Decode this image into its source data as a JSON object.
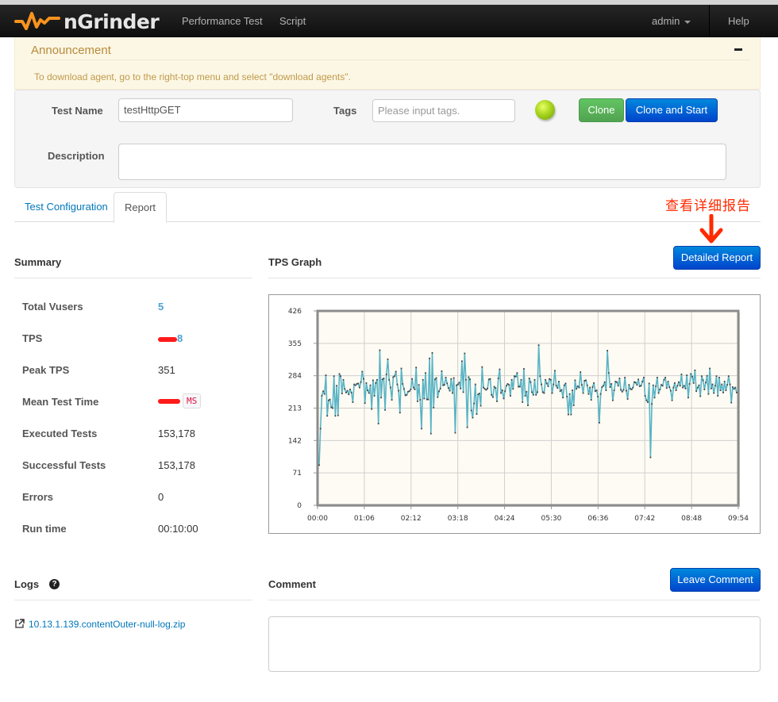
{
  "navbar": {
    "brand": "nGrinder",
    "links": [
      "Performance Test",
      "Script"
    ],
    "user": "admin",
    "help": "Help"
  },
  "announcement": {
    "title": "Announcement",
    "message": "To download agent, go to the right-top menu and select \"download agents\"."
  },
  "test_info": {
    "test_name_label": "Test Name",
    "test_name_value": "testHttpGET",
    "tags_label": "Tags",
    "tags_placeholder": "Please input tags.",
    "description_label": "Description",
    "description_value": "",
    "status": "finished",
    "clone_label": "Clone",
    "clone_start_label": "Clone and Start"
  },
  "tabs": [
    {
      "label": "Test Configuration",
      "active": false
    },
    {
      "label": "Report",
      "active": true
    }
  ],
  "annotation": {
    "text": "查看详细报告",
    "color": "#ff2a00"
  },
  "summary": {
    "title": "Summary",
    "rows": [
      {
        "label": "Total Vusers",
        "value": "5"
      },
      {
        "label": "TPS",
        "value": "[redacted]",
        "redacted": true
      },
      {
        "label": "Peak TPS",
        "value": "351"
      },
      {
        "label": "Mean Test Time",
        "value": "[redacted]",
        "redacted": true,
        "unit": "MS"
      },
      {
        "label": "Executed Tests",
        "value": "153,178"
      },
      {
        "label": "Successful Tests",
        "value": "153,178"
      },
      {
        "label": "Errors",
        "value": "0"
      },
      {
        "label": "Run time",
        "value": "00:10:00"
      }
    ]
  },
  "tps_graph": {
    "title": "TPS Graph",
    "detailed_report_label": "Detailed Report"
  },
  "logs": {
    "title": "Logs",
    "files": [
      "10.13.1.139.contentOuter-null-log.zip"
    ]
  },
  "comment": {
    "title": "Comment",
    "leave_comment_label": "Leave Comment",
    "value": ""
  },
  "chart_data": {
    "type": "line",
    "title": "TPS Graph",
    "xlabel": "",
    "ylabel": "",
    "x_ticks": [
      "00:00",
      "01:06",
      "02:12",
      "03:18",
      "04:24",
      "05:30",
      "06:36",
      "07:42",
      "08:48",
      "09:54"
    ],
    "y_ticks": [
      0,
      71,
      142,
      213,
      284,
      355,
      426
    ],
    "ylim": [
      0,
      426
    ],
    "xlim_seconds": [
      0,
      594
    ],
    "sample_interval_seconds": 3,
    "grid": true,
    "line_color": "#5ab4c5",
    "background": "#fdfbf3",
    "series": [
      {
        "name": "TPS",
        "values": [
          88,
          168,
          240,
          250,
          244,
          285,
          196,
          230,
          232,
          215,
          213,
          283,
          196,
          262,
          197,
          288,
          283,
          245,
          275,
          255,
          247,
          251,
          243,
          254,
          247,
          226,
          265,
          263,
          266,
          267,
          258,
          270,
          293,
          277,
          224,
          268,
          252,
          246,
          263,
          211,
          274,
          240,
          268,
          275,
          179,
          340,
          236,
          276,
          278,
          209,
          287,
          320,
          275,
          258,
          231,
          281,
          283,
          293,
          265,
          251,
          203,
          300,
          266,
          255,
          241,
          242,
          249,
          250,
          254,
          277,
          258,
          254,
          302,
          228,
          264,
          231,
          168,
          275,
          234,
          290,
          232,
          232,
          322,
          157,
          334,
          214,
          276,
          279,
          237,
          250,
          256,
          294,
          263,
          264,
          280,
          267,
          257,
          251,
          277,
          246,
          279,
          159,
          263,
          265,
          269,
          256,
          316,
          248,
          333,
          275,
          171,
          281,
          276,
          208,
          192,
          223,
          265,
          200,
          243,
          245,
          218,
          303,
          258,
          255,
          253,
          256,
          276,
          277,
          242,
          237,
          260,
          257,
          228,
          278,
          298,
          246,
          252,
          234,
          250,
          262,
          266,
          264,
          240,
          275,
          255,
          283,
          282,
          290,
          260,
          260,
          275,
          226,
          299,
          240,
          249,
          219,
          278,
          270,
          248,
          242,
          275,
          242,
          248,
          351,
          283,
          265,
          248,
          246,
          275,
          267,
          261,
          277,
          275,
          246,
          265,
          295,
          262,
          257,
          271,
          250,
          253,
          236,
          263,
          267,
          238,
          199,
          244,
          199,
          252,
          219,
          274,
          255,
          261,
          258,
          292,
          264,
          246,
          273,
          274,
          263,
          244,
          258,
          231,
          259,
          268,
          250,
          252,
          238,
          181,
          244,
          259,
          262,
          270,
          252,
          339,
          290,
          259,
          266,
          230,
          252,
          271,
          270,
          262,
          278,
          253,
          249,
          253,
          280,
          251,
          233,
          264,
          255,
          254,
          258,
          270,
          269,
          264,
          276,
          261,
          262,
          271,
          280,
          240,
          230,
          226,
          267,
          105,
          222,
          263,
          236,
          261,
          280,
          246,
          254,
          264,
          262,
          275,
          280,
          257,
          271,
          259,
          251,
          230,
          258,
          268,
          252,
          262,
          270,
          262,
          287,
          258,
          262,
          256,
          285,
          236,
          266,
          288,
          282,
          268,
          296,
          250,
          258,
          263,
          239,
          283,
          274,
          254,
          269,
          284,
          244,
          300,
          256,
          265,
          246,
          262,
          283,
          240,
          280,
          252,
          265,
          247,
          271,
          252,
          264,
          283,
          265,
          225,
          259,
          255,
          258,
          247
        ]
      }
    ]
  }
}
